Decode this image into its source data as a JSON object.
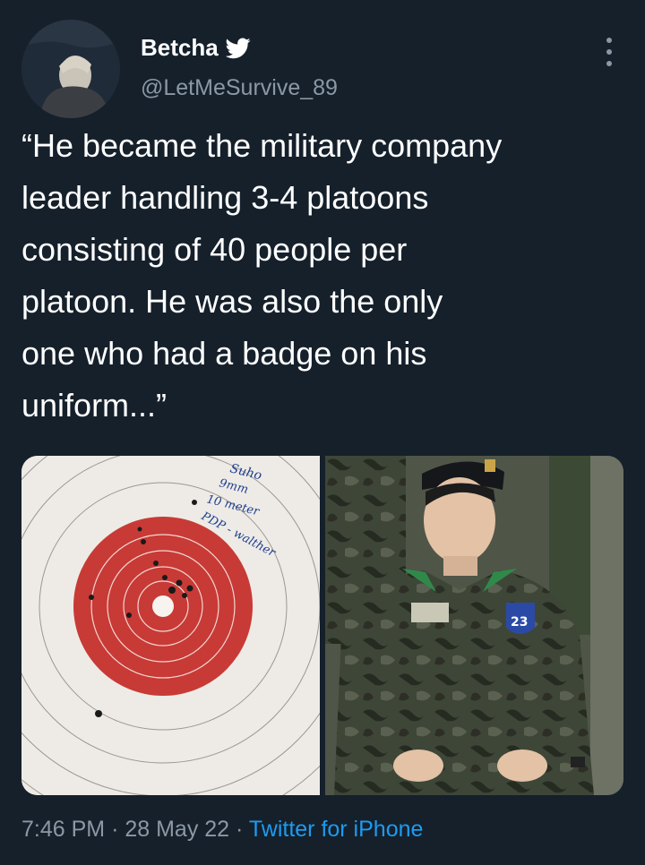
{
  "tweet": {
    "display_name": "Betcha",
    "handle": "@LetMeSurvive_89",
    "text": "“He became the military company\nleader handling 3-4 platoons\nconsisting of 40 people per\nplatoon. He was also the only\none who had a badge on his\nuniform...”",
    "time": "7:46 PM",
    "separator": "·",
    "date": "28 May 22",
    "source": "Twitter for iPhone"
  },
  "target_notes": [
    "Suho",
    "9mm",
    "10 meter",
    "PDP - walther"
  ],
  "icons": {
    "verified": "twitter-bird-icon",
    "more": "more-options-icon"
  },
  "colors": {
    "background": "#15202b",
    "text": "#ffffff",
    "secondary": "#8b98a5",
    "link": "#1d9bf0"
  }
}
